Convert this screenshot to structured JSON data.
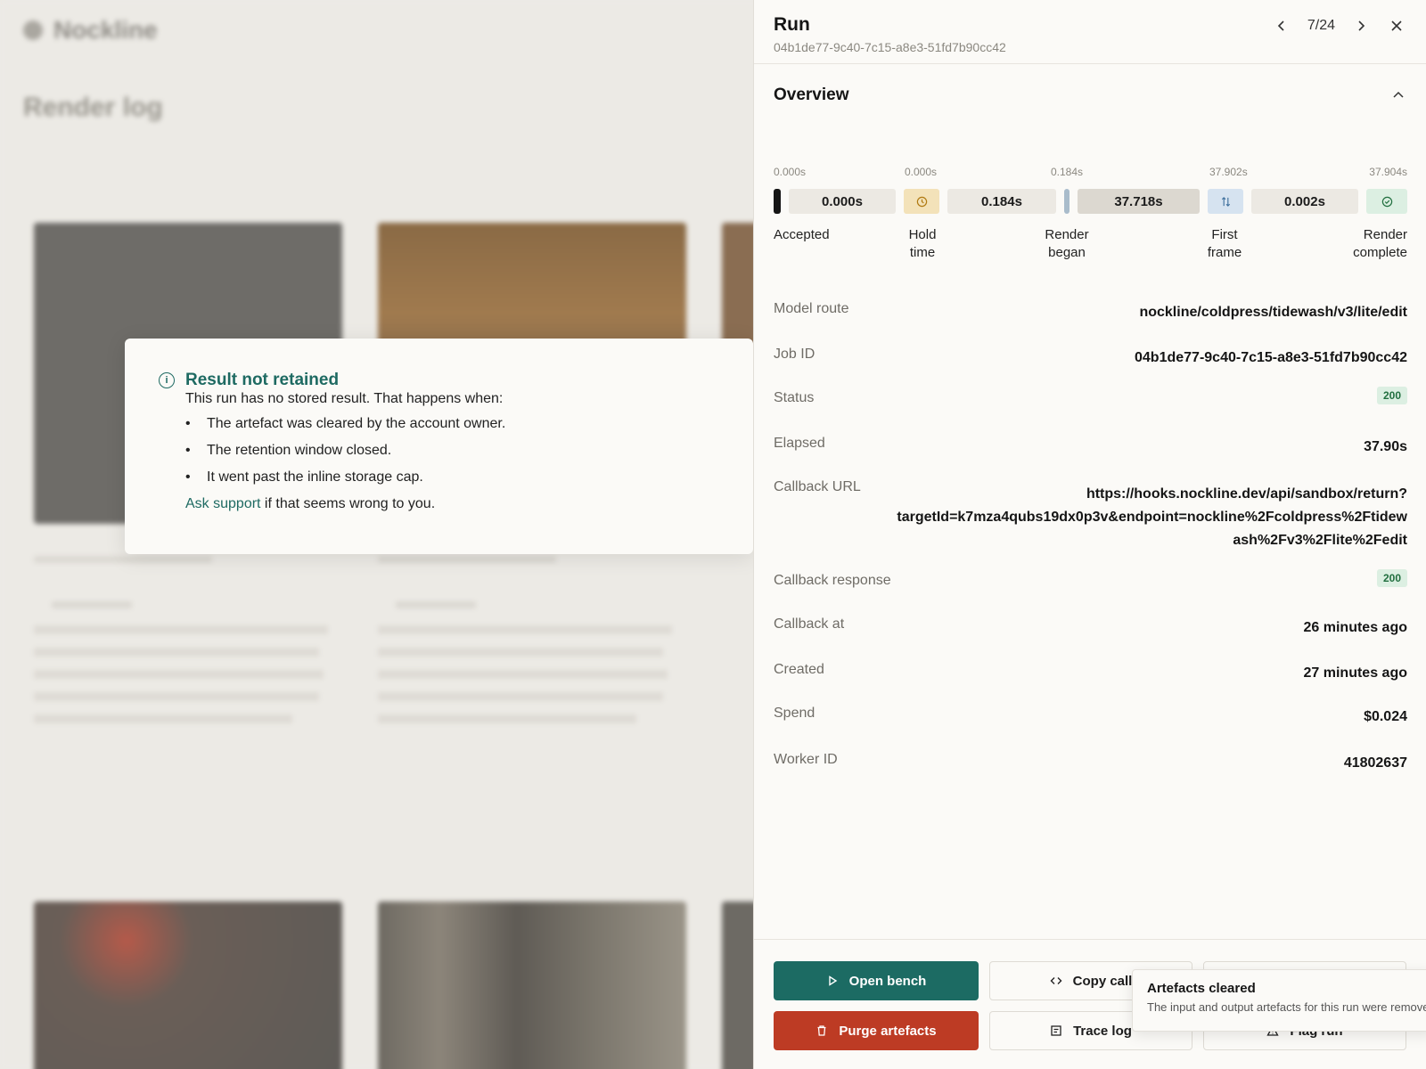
{
  "background": {
    "brand": "Nockline",
    "title": "Render log"
  },
  "notice": {
    "title": "Result not retained",
    "intro": "This run has no stored result. That happens when:",
    "reasons": [
      "The artefact was cleared by the account owner.",
      "The retention window closed.",
      "It went past the inline storage cap."
    ],
    "footer_link": "Ask support",
    "footer_rest": " if that seems wrong to you.",
    "icon": "info-icon"
  },
  "drawer": {
    "title": "Run",
    "run_id": "04b1de77-9c40-7c15-a8e3-51fd7b90cc42",
    "pager": "7/24",
    "overview_title": "Overview",
    "timeline": {
      "ticks": [
        "0.000s",
        "0.000s",
        "0.184s",
        "37.902s",
        "37.904s"
      ],
      "segments": {
        "hold": "0.000s",
        "queue": "0.184s",
        "render": "37.718s",
        "finish": "0.002s"
      },
      "labels": {
        "accepted": "Accepted",
        "hold_1": "Hold",
        "hold_2": "time",
        "began_1": "Render",
        "began_2": "began",
        "first_1": "First",
        "first_2": "frame",
        "complete_1": "Render",
        "complete_2": "complete"
      }
    },
    "details": [
      {
        "key": "Model route",
        "value": "nockline/coldpress/tidewash/v3/lite/edit"
      },
      {
        "key": "Job ID",
        "value": "04b1de77-9c40-7c15-a8e3-51fd7b90cc42"
      },
      {
        "key": "Status",
        "value": "200"
      },
      {
        "key": "Elapsed",
        "value": "37.90s"
      },
      {
        "key": "Callback URL",
        "value_lines": [
          "https://hooks.nockline.dev/api/sandbox/return?",
          "targetId=k7mza4qubs19dx0p3v&endpoint=nockline%2Fcoldpress%2Ftidew",
          "ash%2Fv3%2Flite%2Fedit"
        ]
      },
      {
        "key": "Callback response",
        "value": "200"
      },
      {
        "key": "Callback at",
        "value": "26 minutes ago"
      },
      {
        "key": "Created",
        "value": "27 minutes ago"
      },
      {
        "key": "Spend",
        "value": "$0.024"
      },
      {
        "key": "Worker ID",
        "value": "41802637"
      }
    ],
    "actions": {
      "open_bench": "Open bench",
      "copy_call": "Copy call",
      "purge": "Purge artefacts",
      "trace_log": "Trace log",
      "flag_run": "Flag run"
    }
  },
  "toast": {
    "title": "Artefacts cleared",
    "body": "The input and output artefacts for this run were removed."
  },
  "colors": {
    "accent": "#1c6b63",
    "danger": "#bd3b24",
    "badge_bg": "#dcefe2",
    "badge_fg": "#216f3f"
  }
}
